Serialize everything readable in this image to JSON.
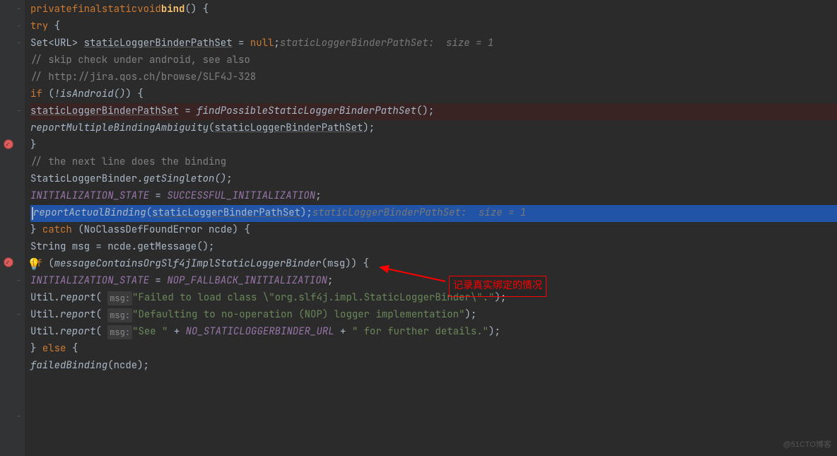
{
  "code": {
    "sig_private": "private",
    "sig_final": "final",
    "sig_static": "static",
    "sig_void": "void",
    "sig_name": "bind",
    "try_kw": "try",
    "set_type": "Set<URL> ",
    "set_var": "staticLoggerBinderPathSet",
    "set_assign": " = ",
    "null_kw": "null",
    "inline_hint1": "staticLoggerBinderPathSet:  size = 1",
    "comment_skip": "// skip check under android, see also",
    "comment_url": "// http://jira.qos.ch/browse/SLF4J-328",
    "if_kw": "if",
    "not_android": "!isAndroid()",
    "assign_left": "staticLoggerBinderPathSet",
    "assign_eq": " = ",
    "find_call": "findPossibleStaticLoggerBinderPathSet",
    "report_multi": "reportMultipleBindingAmbiguity",
    "arg_pathset": "staticLoggerBinderPathSet",
    "comment_next": "// the next line does the binding",
    "slb_class": "StaticLoggerBinder",
    "get_singleton": ".getSingleton()",
    "init_state": "INITIALIZATION_STATE",
    "succ_init": "SUCCESSFUL_INITIALIZATION",
    "report_actual": "reportActualBinding",
    "inline_hint2": "staticLoggerBinderPathSet:  size = 1",
    "catch_kw": "catch",
    "catch_type": "NoClassDefFoundError ncde",
    "msg_decl": "String msg = ncde.getMessage();",
    "msg_contains": "messageContainsOrgSlf4jImplStaticLoggerBinder",
    "nop_fallback": "NOP_FALLBACK_INITIALIZATION",
    "util_class": "Util",
    "report_m": ".report",
    "msg_hint": "msg:",
    "str1": "\"Failed to load class \\\"org.slf4j.impl.StaticLoggerBinder\\\".\"",
    "str2": "\"Defaulting to no-operation (NOP) logger implementation\"",
    "str3a": "\"See \"",
    "str3b": "\" for further details.\"",
    "no_url": "NO_STATICLOGGERBINDER_URL",
    "else_kw": "else",
    "failed_binding": "failedBinding",
    "ncde_arg": "ncde"
  },
  "annotation_text": "记录真实绑定的情况",
  "watermark": "@51CTO博客"
}
